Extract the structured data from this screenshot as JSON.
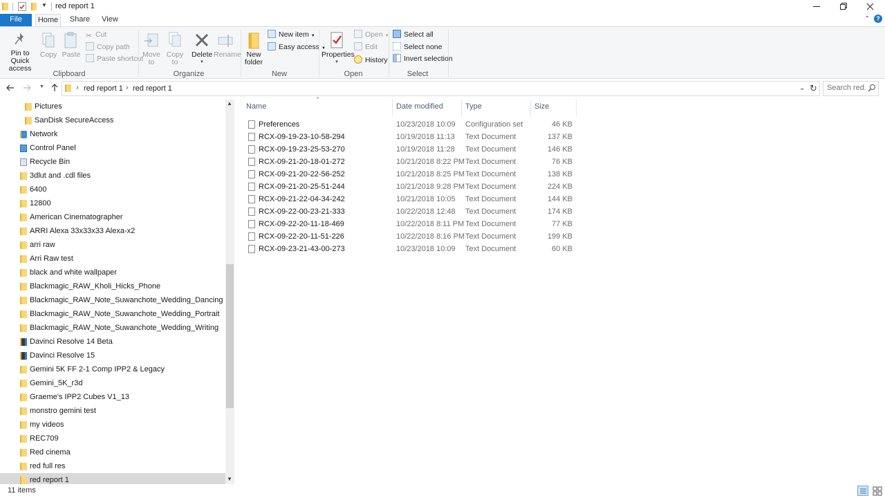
{
  "window": {
    "title": "red report 1",
    "controls": {
      "minimize": "minimize-icon",
      "restore": "restore-icon",
      "close": "close-icon"
    }
  },
  "ribbon_tabs": [
    "File",
    "Home",
    "Share",
    "View"
  ],
  "ribbon": {
    "clipboard": {
      "label": "Clipboard",
      "pin_line1": "Pin to Quick",
      "pin_line2": "access",
      "copy": "Copy",
      "paste": "Paste",
      "cut": "Cut",
      "copy_path": "Copy path",
      "paste_shortcut": "Paste shortcut"
    },
    "organize": {
      "label": "Organize",
      "move_to_line1": "Move",
      "move_to_line2": "to",
      "copy_to_line1": "Copy",
      "copy_to_line2": "to",
      "delete": "Delete",
      "rename": "Rename"
    },
    "new": {
      "label": "New",
      "new_folder_line1": "New",
      "new_folder_line2": "folder",
      "new_item": "New item",
      "easy_access": "Easy access"
    },
    "open": {
      "label": "Open",
      "properties": "Properties",
      "open": "Open",
      "edit": "Edit",
      "history": "History"
    },
    "select": {
      "label": "Select",
      "select_all": "Select all",
      "select_none": "Select none",
      "invert_selection": "Invert selection"
    }
  },
  "address": {
    "crumbs": [
      "red report 1",
      "red report 1"
    ],
    "search_placeholder": "Search red..."
  },
  "nav_items": [
    {
      "label": "Pictures",
      "icon": "folder-icon",
      "indent": 2
    },
    {
      "label": "SanDisk SecureAccess",
      "icon": "folder-icon",
      "indent": 2
    },
    {
      "label": "Network",
      "icon": "network-icon",
      "indent": 1
    },
    {
      "label": "Control Panel",
      "icon": "control-panel-icon",
      "indent": 1
    },
    {
      "label": "Recycle Bin",
      "icon": "recycle-bin-icon",
      "indent": 1
    },
    {
      "label": "3dlut and .cdl files",
      "icon": "folder-icon",
      "indent": 1
    },
    {
      "label": "6400",
      "icon": "folder-icon",
      "indent": 1
    },
    {
      "label": "12800",
      "icon": "folder-icon",
      "indent": 1
    },
    {
      "label": "American Cinematographer",
      "icon": "folder-icon",
      "indent": 1
    },
    {
      "label": "ARRI Alexa 33x33x33 Alexa-x2",
      "icon": "folder-icon",
      "indent": 1
    },
    {
      "label": "arri raw",
      "icon": "folder-icon",
      "indent": 1
    },
    {
      "label": "Arri Raw test",
      "icon": "folder-icon",
      "indent": 1
    },
    {
      "label": "black and white wallpaper",
      "icon": "folder-icon",
      "indent": 1
    },
    {
      "label": "Blackmagic_RAW_Kholi_Hicks_Phone",
      "icon": "folder-icon",
      "indent": 1
    },
    {
      "label": "Blackmagic_RAW_Note_Suwanchote_Wedding_Dancing",
      "icon": "folder-icon",
      "indent": 1
    },
    {
      "label": "Blackmagic_RAW_Note_Suwanchote_Wedding_Portrait",
      "icon": "folder-icon",
      "indent": 1
    },
    {
      "label": "Blackmagic_RAW_Note_Suwanchote_Wedding_Writing",
      "icon": "folder-icon",
      "indent": 1
    },
    {
      "label": "Davinci Resolve 14 Beta",
      "icon": "app-icon",
      "indent": 1
    },
    {
      "label": "Davinci Resolve 15",
      "icon": "app-icon",
      "indent": 1
    },
    {
      "label": "Gemini 5K FF 2-1 Comp IPP2 & Legacy",
      "icon": "folder-icon",
      "indent": 1
    },
    {
      "label": "Gemini_5K_r3d",
      "icon": "folder-icon",
      "indent": 1
    },
    {
      "label": "Graeme's IPP2 Cubes V1_13",
      "icon": "folder-icon",
      "indent": 1
    },
    {
      "label": "monstro gemini test",
      "icon": "folder-icon",
      "indent": 1
    },
    {
      "label": "my videos",
      "icon": "folder-icon",
      "indent": 1
    },
    {
      "label": "REC709",
      "icon": "folder-icon",
      "indent": 1
    },
    {
      "label": "Red cinema",
      "icon": "folder-icon",
      "indent": 1
    },
    {
      "label": "red full res",
      "icon": "folder-icon",
      "indent": 1
    },
    {
      "label": "red report 1",
      "icon": "folder-icon",
      "indent": 1,
      "selected": true
    }
  ],
  "columns": {
    "name": "Name",
    "date": "Date modified",
    "type": "Type",
    "size": "Size"
  },
  "files": [
    {
      "name": "Preferences",
      "date": "10/23/2018 10:09",
      "type": "Configuration setti",
      "size": "46 KB"
    },
    {
      "name": "RCX-09-19-23-10-58-294",
      "date": "10/19/2018 11:13",
      "type": "Text Document",
      "size": "137 KB"
    },
    {
      "name": "RCX-09-19-23-25-53-270",
      "date": "10/19/2018 11:28",
      "type": "Text Document",
      "size": "146 KB"
    },
    {
      "name": "RCX-09-21-20-18-01-272",
      "date": "10/21/2018 8:22 PM",
      "type": "Text Document",
      "size": "76 KB"
    },
    {
      "name": "RCX-09-21-20-22-56-252",
      "date": "10/21/2018 8:25 PM",
      "type": "Text Document",
      "size": "138 KB"
    },
    {
      "name": "RCX-09-21-20-25-51-244",
      "date": "10/21/2018 9:28 PM",
      "type": "Text Document",
      "size": "224 KB"
    },
    {
      "name": "RCX-09-21-22-04-34-242",
      "date": "10/21/2018 10:05",
      "type": "Text Document",
      "size": "144 KB"
    },
    {
      "name": "RCX-09-22-00-23-21-333",
      "date": "10/22/2018 12:48",
      "type": "Text Document",
      "size": "174 KB"
    },
    {
      "name": "RCX-09-22-20-11-18-469",
      "date": "10/22/2018 8:11 PM",
      "type": "Text Document",
      "size": "77 KB"
    },
    {
      "name": "RCX-09-22-20-11-51-226",
      "date": "10/22/2018 8:16 PM",
      "type": "Text Document",
      "size": "199 KB"
    },
    {
      "name": "RCX-09-23-21-43-00-273",
      "date": "10/23/2018 10:09",
      "type": "Text Document",
      "size": "60 KB"
    }
  ],
  "status": {
    "item_count": "11 items"
  },
  "colors": {
    "accent": "#1979ca",
    "selected_bg": "#d9d9d9",
    "folder": "#f8d775"
  }
}
